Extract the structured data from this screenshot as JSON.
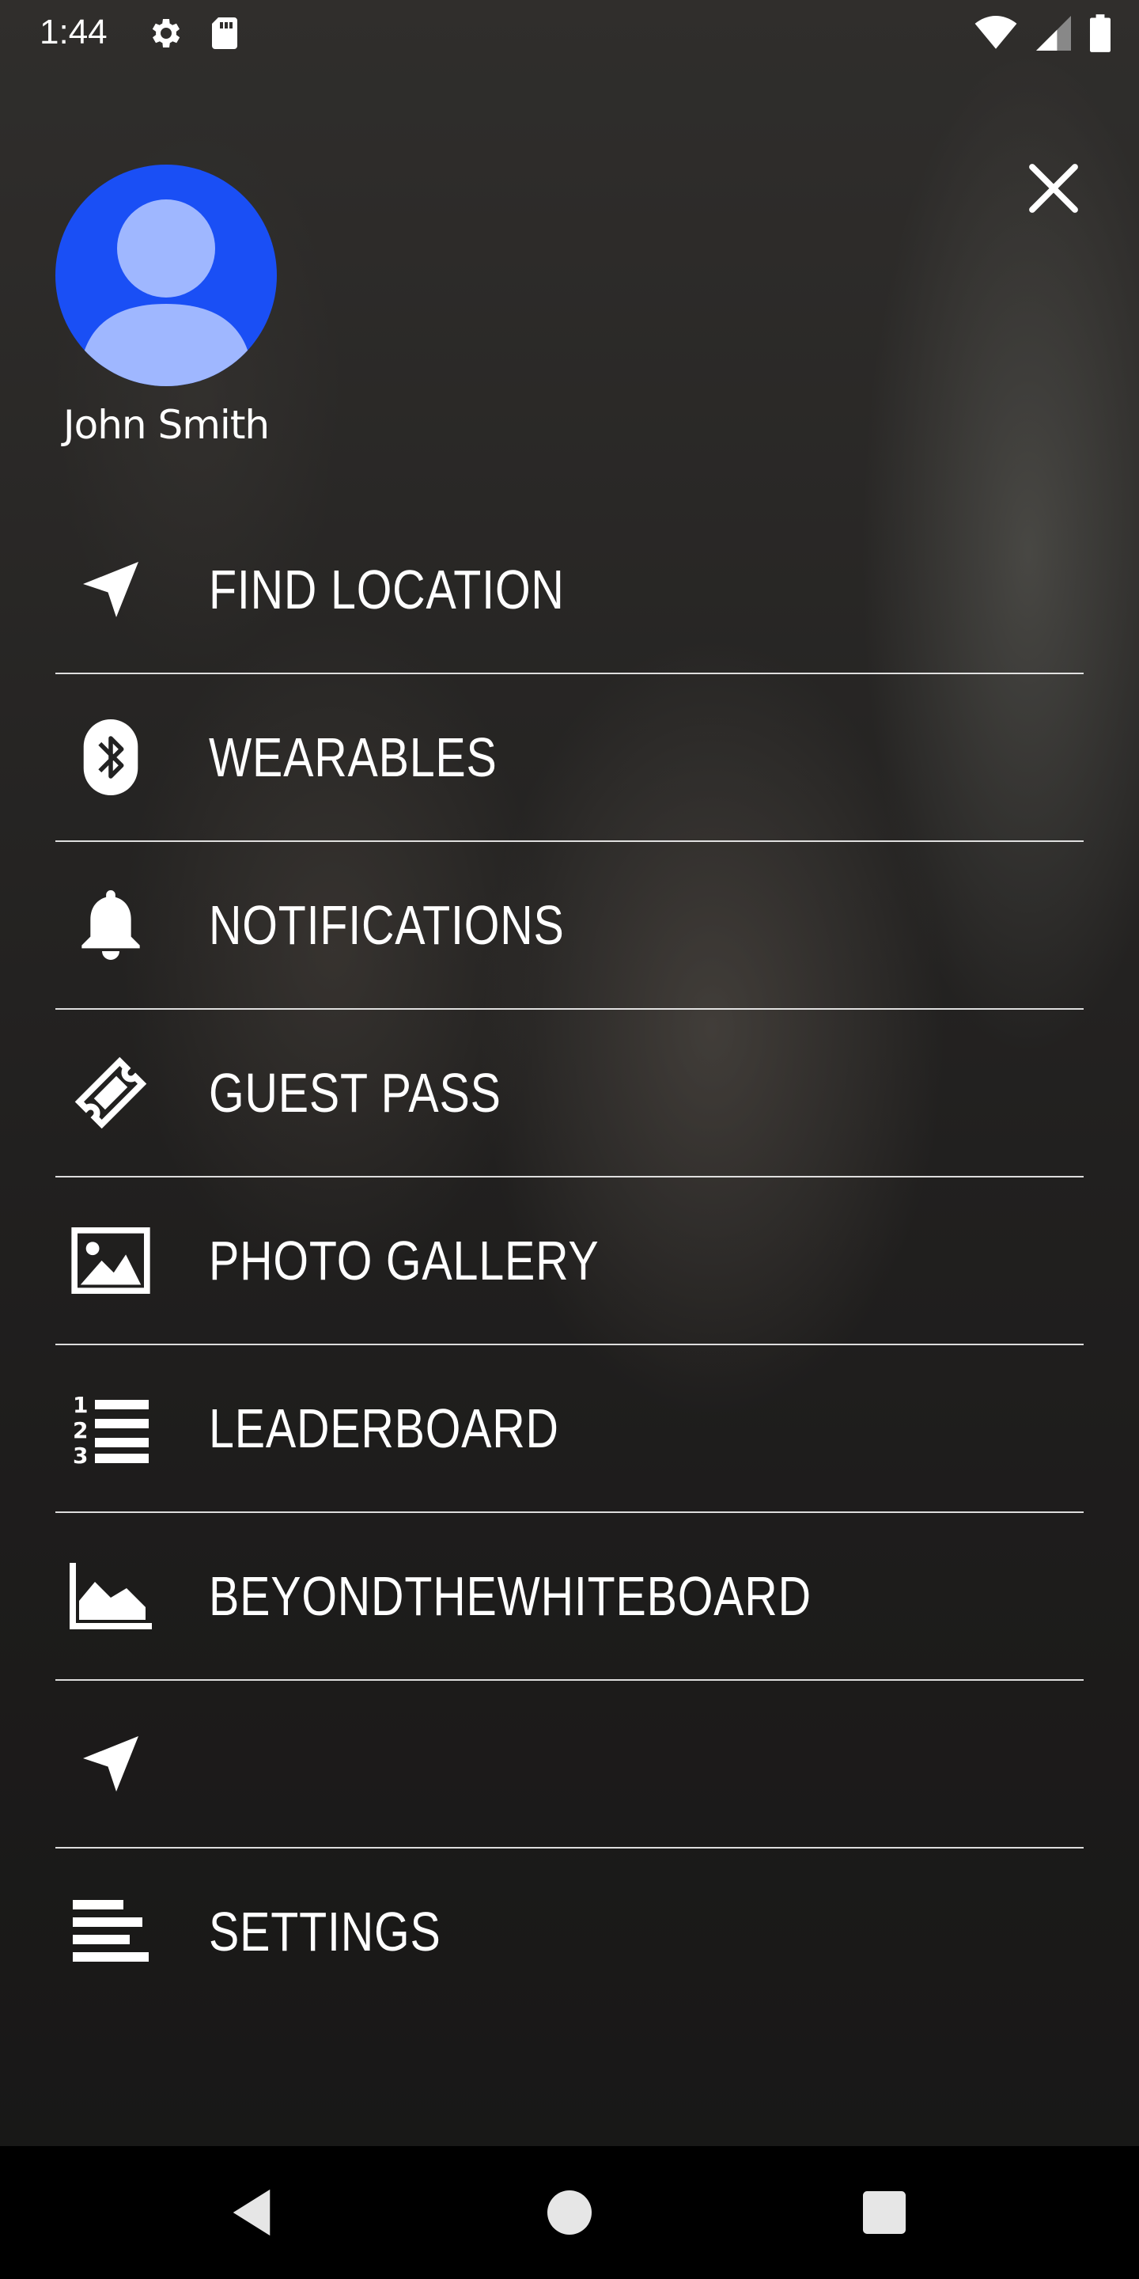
{
  "status_bar": {
    "time": "1:44",
    "icons": [
      "gear-icon",
      "sd-card-icon",
      "wifi-icon",
      "cell-signal-icon",
      "battery-icon"
    ]
  },
  "profile": {
    "name": "John Smith",
    "avatar_color": "#1a4ff5"
  },
  "close_icon": "close-icon",
  "menu": {
    "items": [
      {
        "label": "FIND LOCATION",
        "icon": "navigation-arrow-icon"
      },
      {
        "label": "WEARABLES",
        "icon": "bluetooth-icon"
      },
      {
        "label": "NOTIFICATIONS",
        "icon": "bell-icon"
      },
      {
        "label": "GUEST PASS",
        "icon": "ticket-icon"
      },
      {
        "label": "PHOTO GALLERY",
        "icon": "image-icon"
      },
      {
        "label": "LEADERBOARD",
        "icon": "ordered-list-icon"
      },
      {
        "label": "BEYONDTHEWHITEBOARD",
        "icon": "area-chart-icon"
      },
      {
        "label": "",
        "icon": "navigation-arrow-icon"
      },
      {
        "label": "SETTINGS",
        "icon": "align-left-icon"
      }
    ]
  },
  "nav_bar": {
    "buttons": [
      "back-icon",
      "home-icon",
      "recents-icon"
    ]
  },
  "colors": {
    "accent": "#1a4ff5",
    "text": "#ffffff",
    "nav_background": "#000000"
  }
}
